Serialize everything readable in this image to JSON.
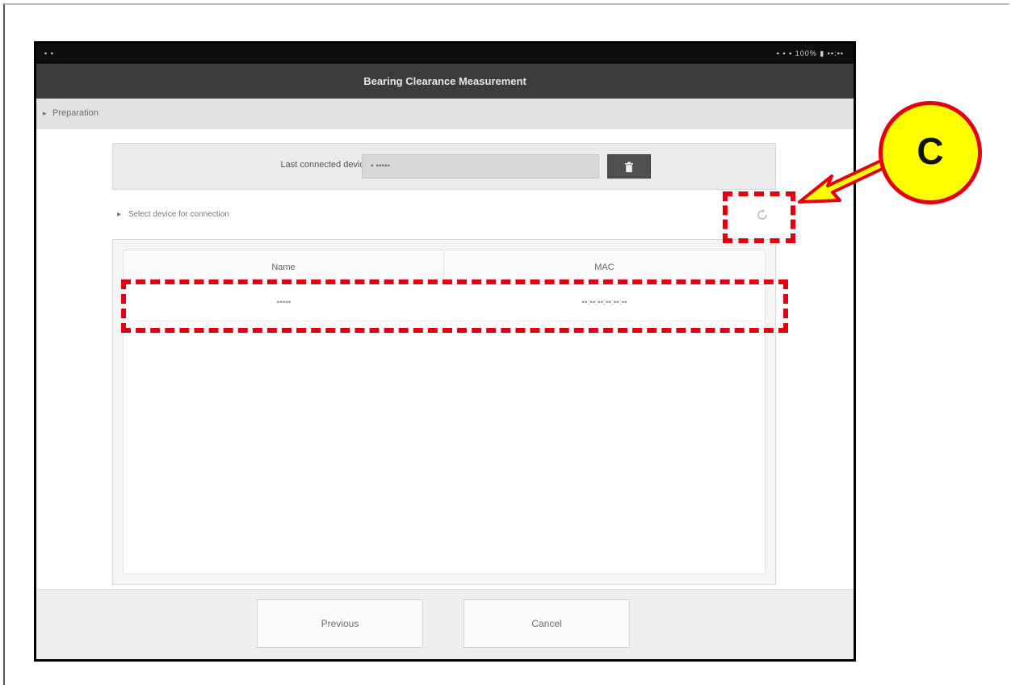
{
  "status_bar": {
    "left": "▪ ▪",
    "right": "▪ ▪ ▪ 100% ▮ ▪▪:▪▪"
  },
  "window": {
    "title": "Bearing Clearance Measurement"
  },
  "section": {
    "label": "Preparation"
  },
  "device": {
    "label": "Last connected device",
    "value": "▪ ▪▪▪▪▪",
    "delete_icon": "trash-icon"
  },
  "select": {
    "label": "Select device for connection",
    "refresh_icon": "refresh-icon"
  },
  "table": {
    "headers": [
      "Name",
      "MAC"
    ],
    "rows": [
      {
        "name": "▪▪▪▪▪",
        "mac": "▪▪:▪▪:▪▪:▪▪:▪▪:▪▪"
      }
    ]
  },
  "footer": {
    "previous_label": "Previous",
    "cancel_label": "Cancel"
  },
  "annotation": {
    "callout_letter": "C",
    "highlight_color": "#e3000f",
    "callout_fill": "#ffff00"
  }
}
